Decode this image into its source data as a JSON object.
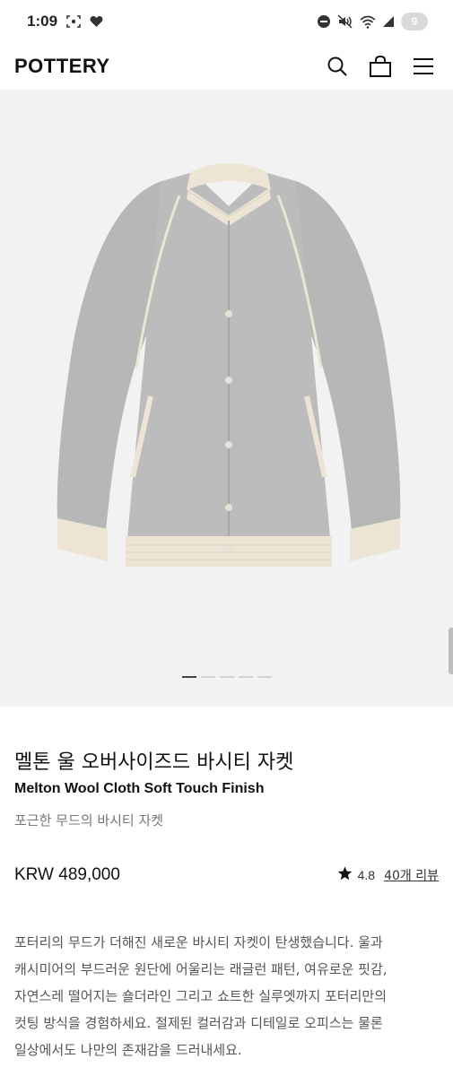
{
  "status_bar": {
    "time": "1:09",
    "battery_level": "9"
  },
  "header": {
    "brand": "POTTERY"
  },
  "gallery": {
    "slide_count": 5,
    "active_slide": 1
  },
  "product": {
    "title_ko": "멜톤 울 오버사이즈드 바시티 자켓",
    "title_en": "Melton Wool Cloth Soft Touch Finish",
    "subtitle": "포근한 무드의 바시티 자켓",
    "price": "KRW 489,000",
    "rating": "4.8",
    "review_link": "40개 리뷰",
    "description_lines": [
      "포터리의 무드가 더해진 새로운 바시티 자켓이 탄생했습니다. 울과",
      "캐시미어의 부드러운 원단에 어울리는 래글런 패턴, 여유로운 핏감,",
      "자연스레 떨어지는 숄더라인 그리고 쇼트한 실루엣까지 포터리만의",
      "컷팅 방식을 경험하세요. 절제된 컬러감과 디테일로 오피스는 물론",
      "일상에서도 나만의 존재감을 드러내세요."
    ]
  },
  "colors": {
    "jacket_body": "#b9b9b9",
    "jacket_trim": "#ece5d6",
    "gallery_bg": "#f2f2f2"
  }
}
